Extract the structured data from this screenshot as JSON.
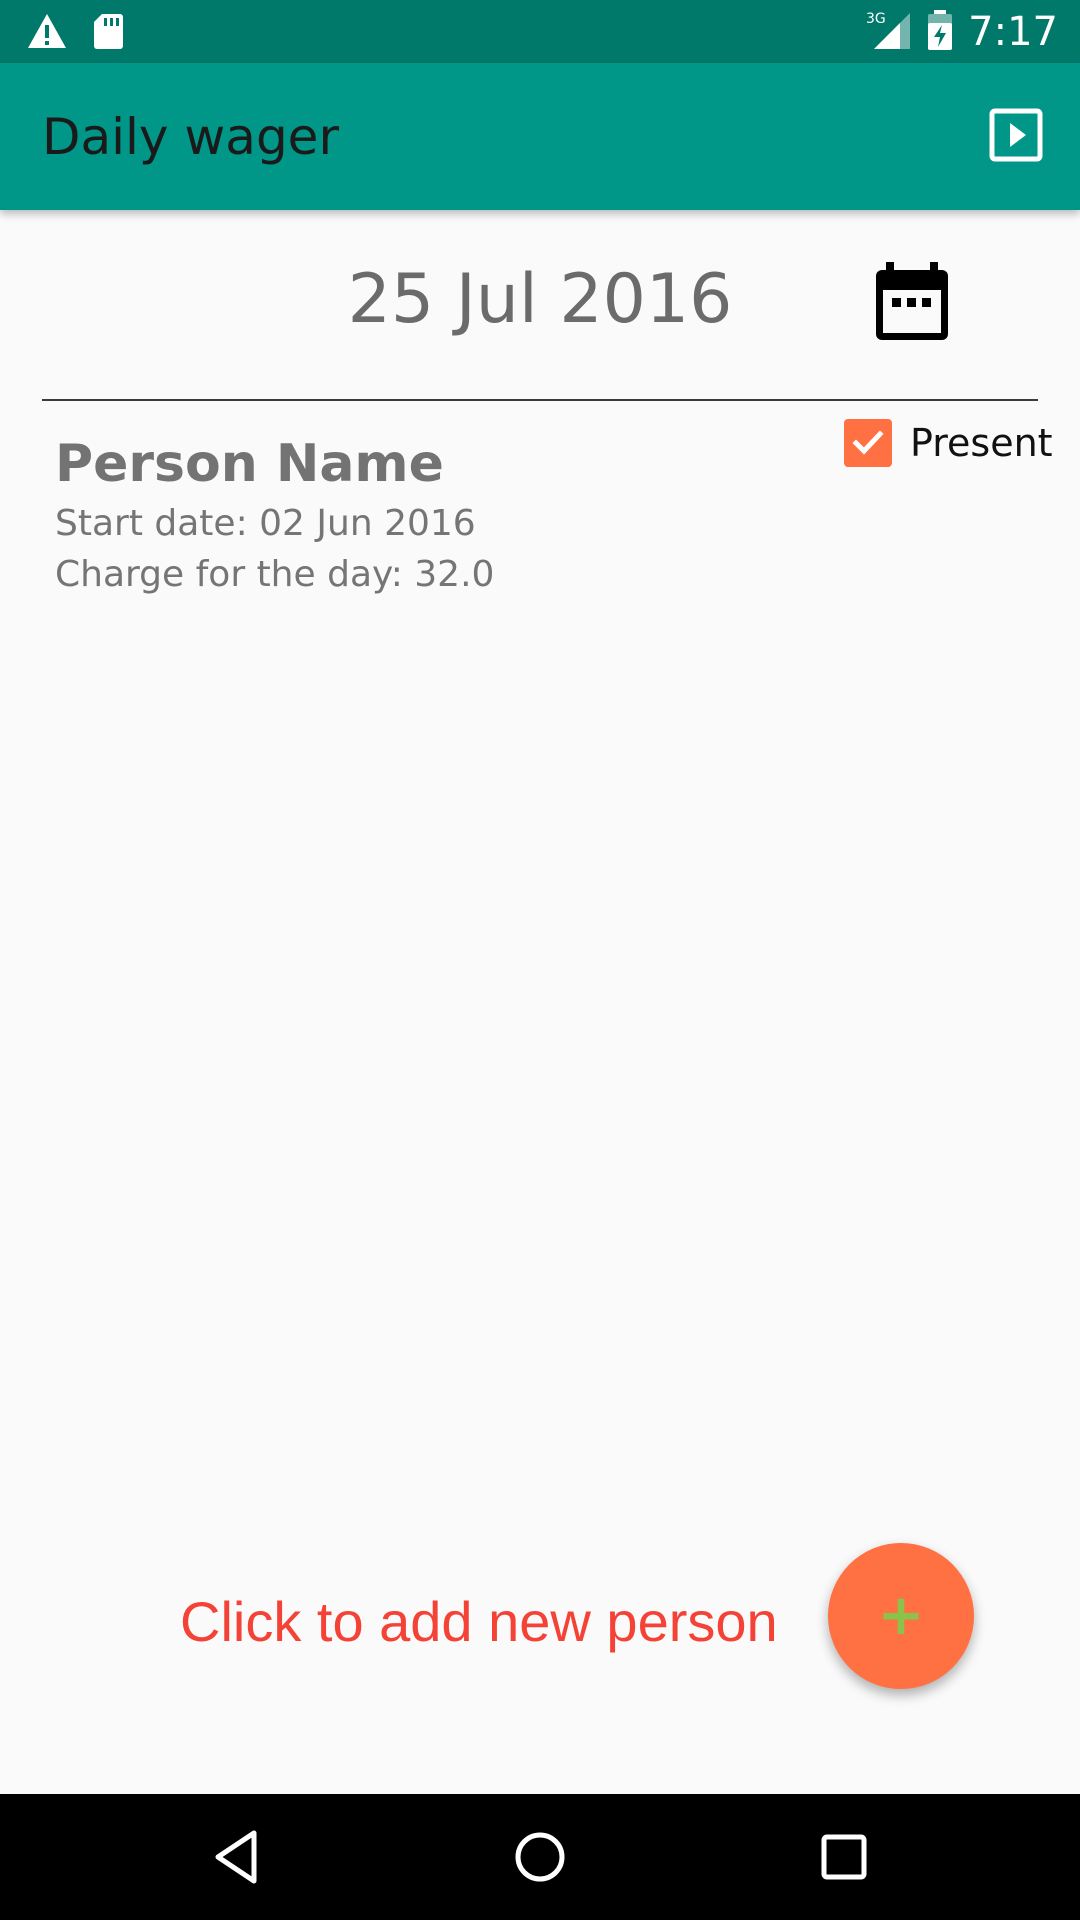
{
  "status_bar": {
    "time": "7:17",
    "network": "3G",
    "icons": [
      "warning-icon",
      "sd-card-icon",
      "signal-icon",
      "battery-icon"
    ]
  },
  "app_bar": {
    "title": "Daily wager",
    "action_icon": "slideshow-icon"
  },
  "date_row": {
    "date": "25 Jul 2016",
    "icon": "calendar-icon"
  },
  "people": [
    {
      "name": "Person Name",
      "start_date": "Start date: 02 Jun 2016",
      "charge": "Charge for the day: 32.0",
      "present_label": "Present",
      "present": true
    }
  ],
  "add_hint": "Click to add new person",
  "fab": {
    "label": "+",
    "icon": "add-icon"
  },
  "nav_bar": {
    "icons": [
      "back-icon",
      "home-icon",
      "recents-icon"
    ]
  },
  "colors": {
    "status_bar": "#00796b",
    "app_bar": "#009688",
    "accent": "#ff7043",
    "hint_text": "#f44336",
    "fab_plus": "#8bc34a",
    "background": "#fafafa"
  }
}
